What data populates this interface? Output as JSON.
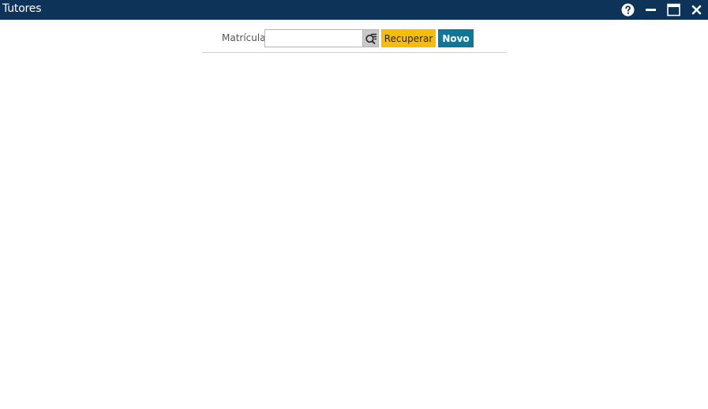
{
  "window": {
    "title": "Tutores",
    "controls": {
      "help": "help-icon",
      "minimize": "minimize-icon",
      "maximize": "maximize-icon",
      "close": "close-icon"
    }
  },
  "search": {
    "label": "Matrícula:",
    "value": "",
    "placeholder": "",
    "lookup_icon": "search-list-icon",
    "recuperar_label": "Recuperar",
    "novo_label": "Novo"
  },
  "colors": {
    "titlebar": "#0e3358",
    "recuperar": "#f7bb0a",
    "novo": "#0f7898"
  }
}
